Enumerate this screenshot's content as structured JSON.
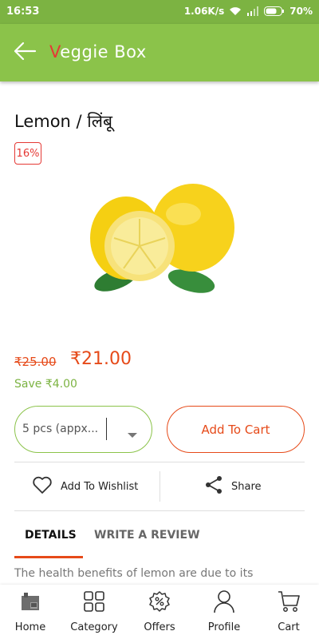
{
  "status_bar": {
    "time": "16:53",
    "speed": "1.06K/s",
    "battery": "70%"
  },
  "app_bar": {
    "title_first": "V",
    "title_rest": "eggie Box"
  },
  "product": {
    "title": "Lemon / लिंबू",
    "discount": "16%",
    "mrp": "₹25.00",
    "price": "₹21.00",
    "save": "Save ₹4.00",
    "quantity_selected": "5 pcs (appx...",
    "description": "The health benefits of lemon are due to its"
  },
  "actions": {
    "add_to_cart": "Add To Cart",
    "wishlist": "Add To Wishlist",
    "share": "Share"
  },
  "tabs": {
    "details": "DETAILS",
    "review": "WRITE A REVIEW"
  },
  "bottom_nav": {
    "home": "Home",
    "category": "Category",
    "offers": "Offers",
    "profile": "Profile",
    "cart": "Cart"
  },
  "colors": {
    "brand_green": "#8bc34a",
    "accent_orange": "#e64a19",
    "badge_red": "#e53935"
  },
  "icons": [
    "back-arrow-icon",
    "wifi-icon",
    "signal-icon",
    "battery-icon",
    "chevron-down-icon",
    "heart-icon",
    "share-icon",
    "home-icon",
    "category-grid-icon",
    "offers-badge-icon",
    "profile-icon",
    "cart-icon"
  ]
}
